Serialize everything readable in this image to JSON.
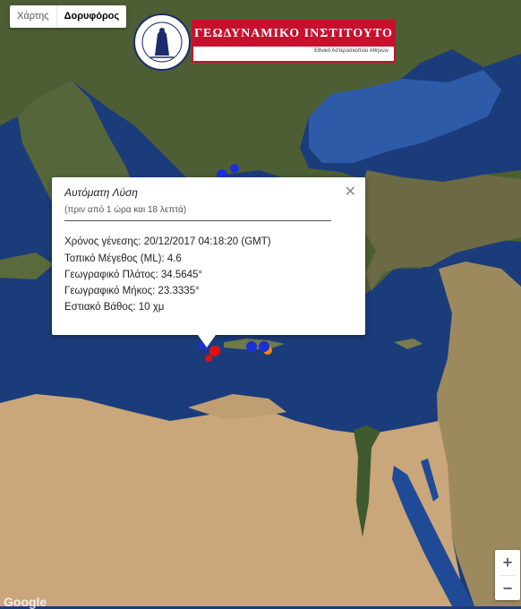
{
  "map_type": {
    "map_label": "Χάρτης",
    "satellite_label": "Δορυφόρος",
    "selected": "Δορυφόρος"
  },
  "logo": {
    "title": "ΓΕΩΔΥΝΑΜΙΚΟ ΙΝΣΤΙΤΟΥΤΟ",
    "subtitle": "Εθνικό Αστεροσκοπείο Αθηνών",
    "seal_text": "ΕΘΝΙΚΟΝ ΑΣΤΕΡΟΣΚΟΠΕΙΟΝ ΑΘΗΝΩΝ · NATIONAL OBSERVATORY OF ATHENS"
  },
  "popup": {
    "title": "Αυτόματη Λύση",
    "ago": "(πριν από 1 ώρα και 18 λεπτά)",
    "origin_time_label": "Χρόνος γένεσης:",
    "origin_time_value": "20/12/2017  04:18:20 (GMT)",
    "magnitude_label": "Τοπικό Μέγεθος (ML):",
    "magnitude_value": "4.6",
    "latitude_label": "Γεωγραφικό Πλάτος:",
    "latitude_value": "34.5645°",
    "longitude_label": "Γεωγραφικό Μήκος:",
    "longitude_value": "23.3335°",
    "depth_label": "Εστιακό Βάθος:",
    "depth_value": "10 χμ"
  },
  "zoom": {
    "in": "+",
    "out": "−"
  },
  "attribution": "Google",
  "colors": {
    "sea_deep": "#1b3c7a",
    "sea_shallow": "#2d5ba8",
    "land_green": "#4d5e35",
    "land_desert": "#c9a77b",
    "marker_blue": "#1a2fd6",
    "marker_red": "#e01010",
    "marker_orange": "#f08a10",
    "logo_red": "#c8102e"
  },
  "markers": [
    {
      "color": "blue",
      "lat": 40.8,
      "lon": 22.9
    },
    {
      "color": "blue",
      "lat": 41.0,
      "lon": 23.4
    },
    {
      "color": "blue",
      "lat": 35.1,
      "lon": 23.3
    },
    {
      "color": "red",
      "lat": 34.9,
      "lon": 23.4
    },
    {
      "color": "red",
      "lat": 34.5645,
      "lon": 23.3335
    },
    {
      "color": "blue",
      "lat": 35.1,
      "lon": 25.2
    },
    {
      "color": "blue",
      "lat": 35.1,
      "lon": 25.5
    },
    {
      "color": "orange",
      "lat": 34.95,
      "lon": 25.6
    }
  ]
}
